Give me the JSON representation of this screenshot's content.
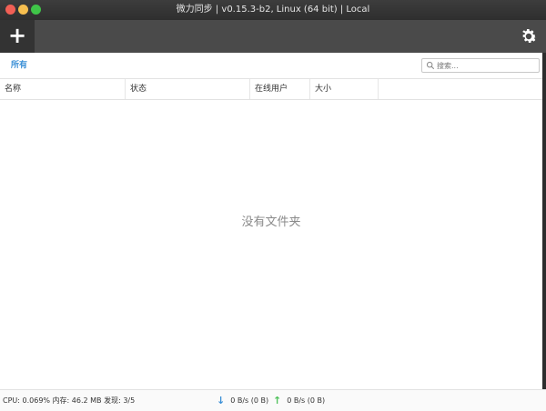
{
  "window": {
    "title": "微力同步 | v0.15.3-b2, Linux (64 bit) | Local"
  },
  "toolbar": {
    "add_label": "+"
  },
  "filter": {
    "all_label": "所有",
    "search_placeholder": "搜索..."
  },
  "table": {
    "columns": [
      "名称",
      "状态",
      "在线用户",
      "大小"
    ]
  },
  "main": {
    "empty_message": "没有文件夹"
  },
  "status": {
    "system": "CPU: 0.069% 内存: 46.2 MB 发现: 3/5",
    "download": "0 B/s (0 B)",
    "upload": "0 B/s (0 B)"
  },
  "colors": {
    "accent": "#3a8fd6",
    "download_arrow": "#3a8fd6",
    "upload_arrow": "#4ec15a",
    "toolbar": "#4a4a4a"
  }
}
